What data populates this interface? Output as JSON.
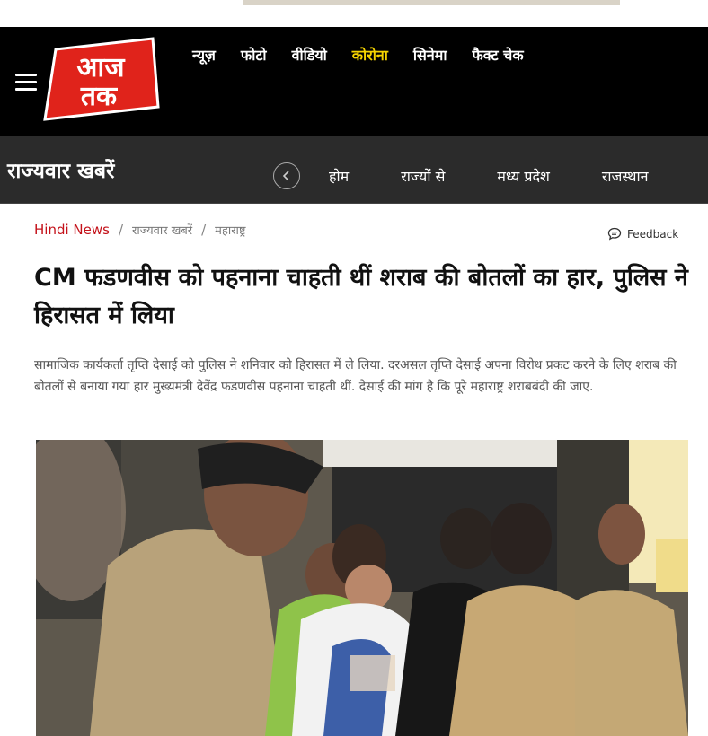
{
  "logo": {
    "line1": "आज",
    "line2": "तक"
  },
  "nav": {
    "items": [
      {
        "label": "न्यूज़",
        "highlight": false
      },
      {
        "label": "फोटो",
        "highlight": false
      },
      {
        "label": "वीडियो",
        "highlight": false
      },
      {
        "label": "कोरोना",
        "highlight": true
      },
      {
        "label": "सिनेमा",
        "highlight": false
      },
      {
        "label": "फैक्ट चेक",
        "highlight": false
      }
    ]
  },
  "subnav": {
    "title": "राज्यवार खबरें",
    "items": [
      "होम",
      "राज्यों से",
      "मध्य प्रदेश",
      "राजस्थान"
    ]
  },
  "breadcrumb": {
    "home": "Hindi News",
    "section": "राज्यवार खबरें",
    "state": "महाराष्ट्र"
  },
  "feedback": {
    "label": "Feedback"
  },
  "article": {
    "headline": "CM फडणवीस को पहनाना चाहती थीं शराब की बोतलों का हार, पुलिस ने हिरासत में लिया",
    "summary": "सामाजिक कार्यकर्ता तृप्ति देसाई को पुलिस ने शनिवार को हिरासत में ले लिया. दरअसल तृप्ति देसाई अपना विरोध प्रकट करने के लिए शराब की बोतलों से बनाया गया हार मुख्यमंत्री देवेंद्र फडणवीस पहनाना चाहती थीं. देसाई की मांग है कि पूरे महाराष्ट्र शराबबंदी की जाए."
  },
  "colors": {
    "header_bg": "#000000",
    "subnav_bg": "#2b2b2b",
    "accent_red": "#c4121a",
    "nav_highlight": "#f5d300"
  },
  "icons": {
    "menu": "hamburger-icon",
    "prev": "chevron-left-icon",
    "feedback": "feedback-icon"
  }
}
